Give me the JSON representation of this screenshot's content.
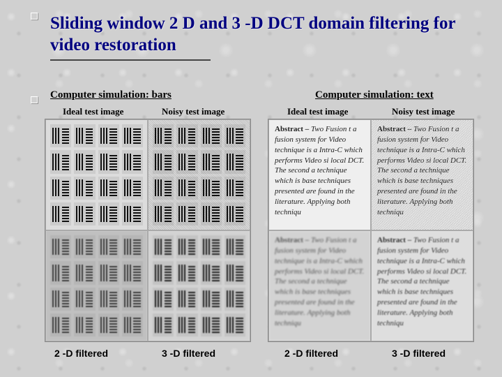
{
  "title": "Sliding window 2 D and 3 -D DCT domain filtering for video restoration",
  "groups": {
    "left": {
      "heading": "Computer simulation: bars"
    },
    "right": {
      "heading": "Computer simulation: text"
    }
  },
  "columns": {
    "ideal": "Ideal test image",
    "noisy": "Noisy test image"
  },
  "bottom": {
    "two_d": "2 -D filtered",
    "three_d": "3 -D filtered"
  },
  "text_sample": {
    "lead": "Abstract –",
    "body": "Two Fusion t a fusion system for Video technique is a Intra-C which performs Video si local DCT. The second a technique which is base techniques presented are found in the literature. Applying both techniqu"
  }
}
